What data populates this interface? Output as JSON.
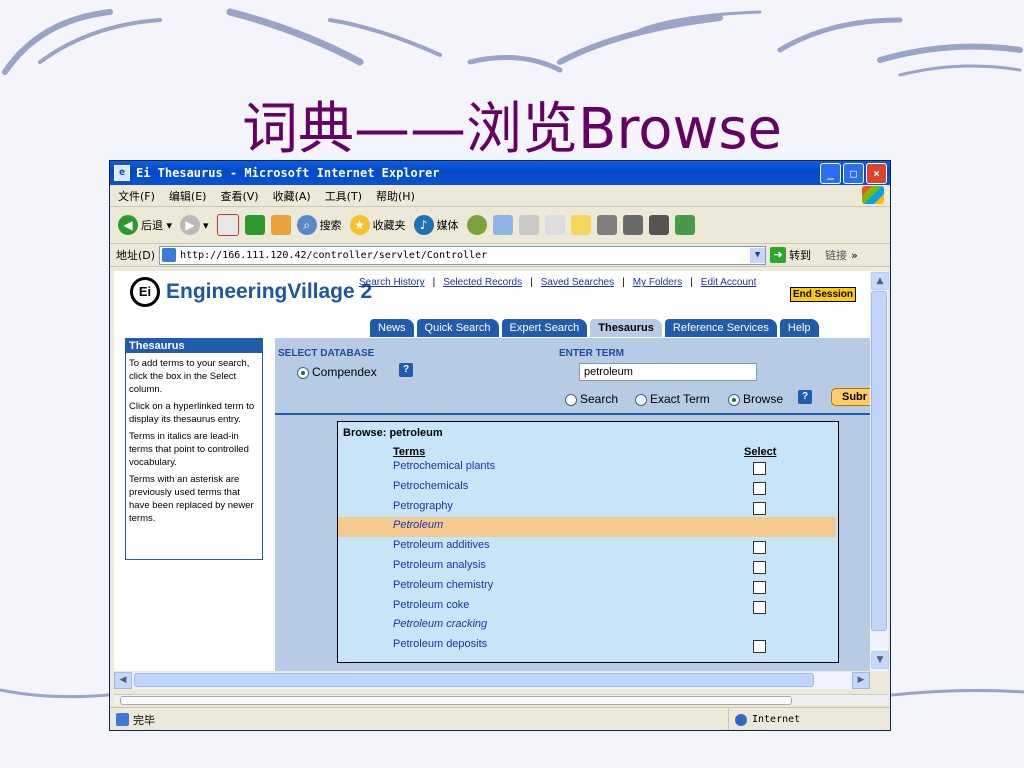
{
  "slide": {
    "title": "词典——浏览Browse"
  },
  "window": {
    "title": "Ei Thesaurus - Microsoft Internet Explorer",
    "buttons": {
      "minimize": "_",
      "maximize": "□",
      "close": "×"
    }
  },
  "menubar": {
    "items": [
      "文件(F)",
      "编辑(E)",
      "查看(V)",
      "收藏(A)",
      "工具(T)",
      "帮助(H)"
    ]
  },
  "toolbar": {
    "back": "后退",
    "search": "搜索",
    "favorites": "收藏夹",
    "media": "媒体"
  },
  "addressbar": {
    "label": "地址(D)",
    "url": "http://166.111.120.42/controller/servlet/Controller",
    "go": "转到",
    "links": "链接"
  },
  "page": {
    "logo": {
      "ei": "Ei",
      "name_a": "Engineering ",
      "name_b": "Village 2"
    },
    "toplinks": [
      "Search History",
      "Selected Records",
      "Saved Searches",
      "My Folders",
      "Edit Account"
    ],
    "end_session": "End Session",
    "tabs": [
      "News",
      "Quick Search",
      "Expert Search",
      "Thesaurus",
      "Reference Services",
      "Help"
    ],
    "sidebar": {
      "heading": "Thesaurus",
      "paragraphs": [
        "To add terms to your search, click the box in the Select column.",
        "Click on a hyperlinked term to display its thesaurus entry.",
        "Terms in italics are lead-in terms that point to controlled vocabulary.",
        "Terms with an asterisk are previously used terms that have been replaced by newer terms."
      ]
    },
    "form": {
      "select_database_label": "SELECT DATABASE",
      "database": "Compendex",
      "enter_term_label": "ENTER TERM",
      "term_value": "petroleum",
      "modes": [
        "Search",
        "Exact Term",
        "Browse"
      ],
      "selected_mode": "Browse",
      "help": "?",
      "submit": "Subr"
    },
    "browse": {
      "heading": "Browse: petroleum",
      "col_terms": "Terms",
      "col_select": "Select",
      "rows": [
        {
          "term": "Petrochemical plants",
          "italic": false,
          "selectable": true,
          "highlight": false
        },
        {
          "term": "Petrochemicals",
          "italic": false,
          "selectable": true,
          "highlight": false
        },
        {
          "term": "Petrography",
          "italic": false,
          "selectable": true,
          "highlight": false
        },
        {
          "term": "Petroleum",
          "italic": true,
          "selectable": false,
          "highlight": true
        },
        {
          "term": "Petroleum additives",
          "italic": false,
          "selectable": true,
          "highlight": false
        },
        {
          "term": "Petroleum analysis",
          "italic": false,
          "selectable": true,
          "highlight": false
        },
        {
          "term": "Petroleum chemistry",
          "italic": false,
          "selectable": true,
          "highlight": false
        },
        {
          "term": "Petroleum coke",
          "italic": false,
          "selectable": true,
          "highlight": false
        },
        {
          "term": "Petroleum cracking",
          "italic": true,
          "selectable": false,
          "highlight": false
        },
        {
          "term": "Petroleum deposits",
          "italic": false,
          "selectable": true,
          "highlight": false
        }
      ]
    }
  },
  "statusbar": {
    "status": "完毕",
    "zone": "Internet"
  },
  "colors": {
    "title": "#660066",
    "brand": "#1c57a5",
    "tab": "#1f5cae",
    "highlight": "#f2ca8f",
    "browse_bg": "#c7e5f7",
    "panel_bg": "#b7cbe5",
    "end_session": "#ffcc00"
  }
}
